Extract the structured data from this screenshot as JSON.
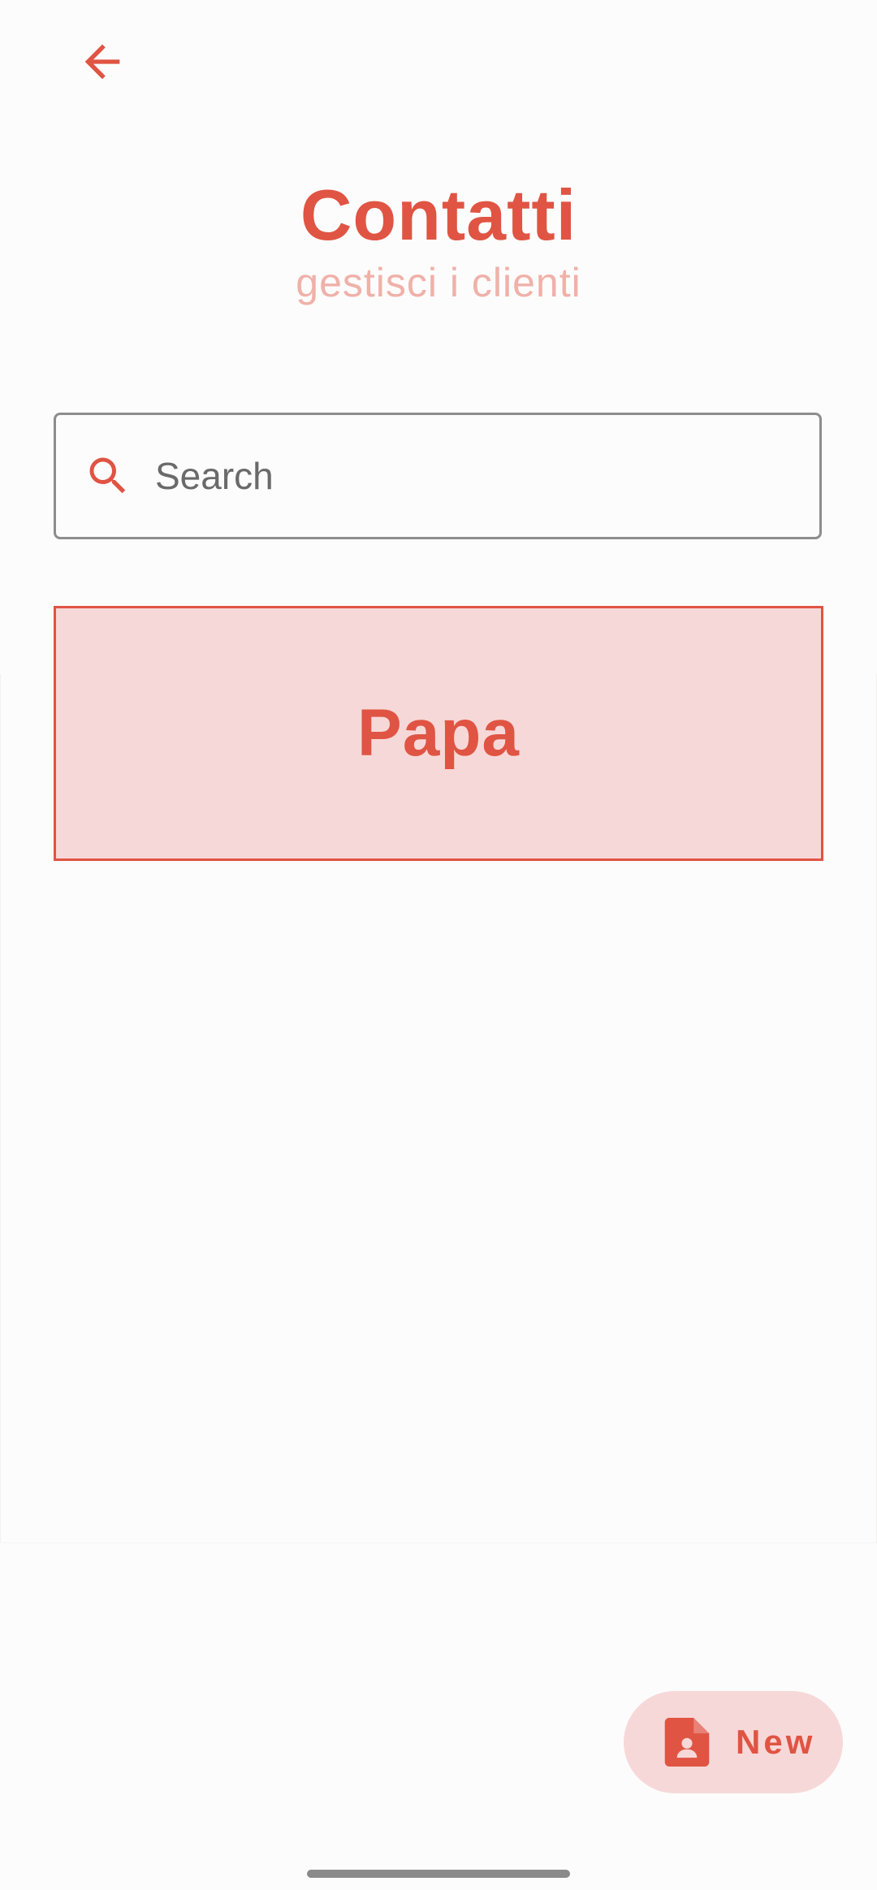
{
  "app": {
    "accent_color": "#e05443",
    "subtitle_color": "#f0b1a9",
    "card_background": "#f7d8d8"
  },
  "header": {
    "back_icon": "arrow-left-icon",
    "title": "Contatti",
    "subtitle": "gestisci i clienti"
  },
  "search": {
    "icon": "search-icon",
    "placeholder": "Search",
    "value": ""
  },
  "contacts": [
    {
      "name": "Papa"
    }
  ],
  "fab": {
    "icon": "contact-document-icon",
    "label": "New"
  }
}
